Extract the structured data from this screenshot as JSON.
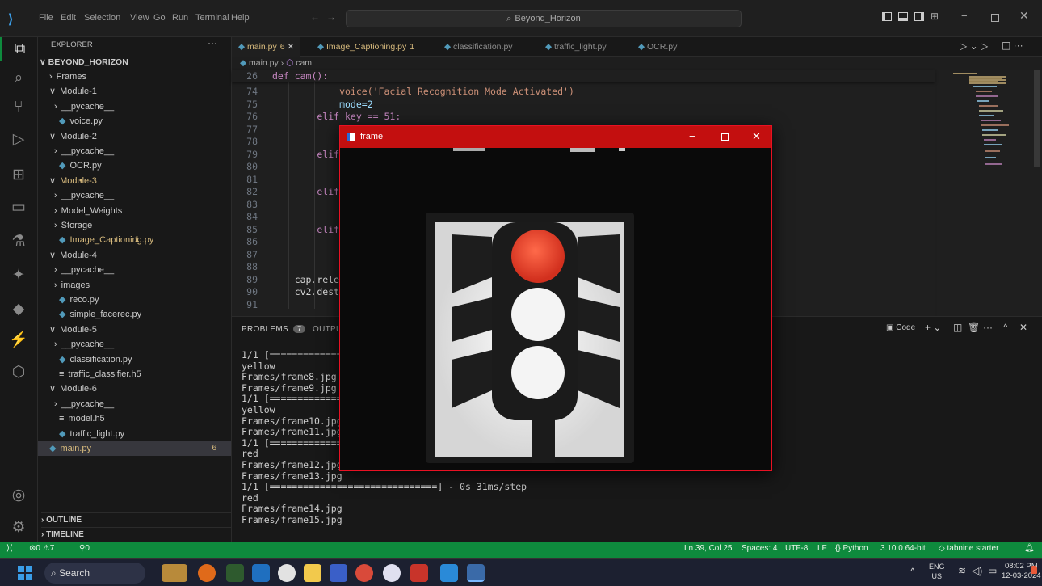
{
  "titlebar": {
    "menus": [
      "File",
      "Edit",
      "Selection",
      "View",
      "Go",
      "Run",
      "Terminal",
      "Help"
    ],
    "search_text": "Beyond_Horizon"
  },
  "sidebar": {
    "header": "EXPLORER",
    "project": "BEYOND_HORIZON",
    "items": [
      {
        "label": "Frames",
        "depth": 1,
        "kind": "folder",
        "open": false
      },
      {
        "label": "Module-1",
        "depth": 1,
        "kind": "folder",
        "open": true
      },
      {
        "label": "__pycache__",
        "depth": 2,
        "kind": "folder",
        "open": false
      },
      {
        "label": "voice.py",
        "depth": 2,
        "kind": "py"
      },
      {
        "label": "Module-2",
        "depth": 1,
        "kind": "folder",
        "open": true
      },
      {
        "label": "__pycache__",
        "depth": 2,
        "kind": "folder",
        "open": false
      },
      {
        "label": "OCR.py",
        "depth": 2,
        "kind": "py"
      },
      {
        "label": "Module-3",
        "depth": 1,
        "kind": "folder",
        "open": true,
        "modified": true
      },
      {
        "label": "__pycache__",
        "depth": 2,
        "kind": "folder",
        "open": false
      },
      {
        "label": "Model_Weights",
        "depth": 2,
        "kind": "folder",
        "open": false
      },
      {
        "label": "Storage",
        "depth": 2,
        "kind": "folder",
        "open": false
      },
      {
        "label": "Image_Captioning.py",
        "depth": 2,
        "kind": "py",
        "modified": true,
        "count": "1"
      },
      {
        "label": "Module-4",
        "depth": 1,
        "kind": "folder",
        "open": true
      },
      {
        "label": "__pycache__",
        "depth": 2,
        "kind": "folder",
        "open": false
      },
      {
        "label": "images",
        "depth": 2,
        "kind": "folder",
        "open": false
      },
      {
        "label": "reco.py",
        "depth": 2,
        "kind": "py"
      },
      {
        "label": "simple_facerec.py",
        "depth": 2,
        "kind": "py"
      },
      {
        "label": "Module-5",
        "depth": 1,
        "kind": "folder",
        "open": true
      },
      {
        "label": "__pycache__",
        "depth": 2,
        "kind": "folder",
        "open": false
      },
      {
        "label": "classification.py",
        "depth": 2,
        "kind": "py"
      },
      {
        "label": "traffic_classifier.h5",
        "depth": 2,
        "kind": "h5"
      },
      {
        "label": "Module-6",
        "depth": 1,
        "kind": "folder",
        "open": true
      },
      {
        "label": "__pycache__",
        "depth": 2,
        "kind": "folder",
        "open": false
      },
      {
        "label": "model.h5",
        "depth": 2,
        "kind": "h5"
      },
      {
        "label": "traffic_light.py",
        "depth": 2,
        "kind": "py"
      },
      {
        "label": "main.py",
        "depth": 1,
        "kind": "py",
        "modified": true,
        "selected": true,
        "count": "6"
      }
    ],
    "outline": "OUTLINE",
    "timeline": "TIMELINE"
  },
  "tabs": [
    {
      "label": "main.py",
      "badge": "6",
      "active": true
    },
    {
      "label": "Image_Captioning.py",
      "badge": "1"
    },
    {
      "label": "classification.py"
    },
    {
      "label": "traffic_light.py"
    },
    {
      "label": "OCR.py"
    }
  ],
  "breadcrumb": {
    "file": "main.py",
    "symbol": "cam"
  },
  "code": {
    "sticky": {
      "num": "26",
      "text": "def cam():"
    },
    "lines": [
      {
        "num": "74",
        "text": "            voice('Facial Recognition Mode Activated')"
      },
      {
        "num": "75",
        "text": "            mode=2"
      },
      {
        "num": "76",
        "text": "        elif key == 51:"
      },
      {
        "num": "77",
        "text": ""
      },
      {
        "num": "78",
        "text": ""
      },
      {
        "num": "79",
        "text": "        elif"
      },
      {
        "num": "80",
        "text": ""
      },
      {
        "num": "81",
        "text": ""
      },
      {
        "num": "82",
        "text": "        elif"
      },
      {
        "num": "83",
        "text": ""
      },
      {
        "num": "84",
        "text": ""
      },
      {
        "num": "85",
        "text": "        elif"
      },
      {
        "num": "86",
        "text": ""
      },
      {
        "num": "87",
        "text": ""
      },
      {
        "num": "88",
        "text": ""
      },
      {
        "num": "89",
        "text": "    cap.rele"
      },
      {
        "num": "90",
        "text": "    cv2.dest"
      },
      {
        "num": "91",
        "text": ""
      }
    ]
  },
  "panel": {
    "tabs": [
      "PROBLEMS",
      "OUTPUT"
    ],
    "problems_count": "7",
    "terminal_label": "Code",
    "lines": [
      "1/1 [=============",
      "yellow",
      "Frames/frame8.jpg",
      "Frames/frame9.jpg",
      "1/1 [=============",
      "yellow",
      "Frames/frame10.jpg",
      "Frames/frame11.jpg",
      "1/1 [=============",
      "red",
      "Frames/frame12.jpg",
      "Frames/frame13.jpg",
      "1/1 [==============================] - 0s 31ms/step",
      "red",
      "Frames/frame14.jpg",
      "Frames/frame15.jpg"
    ]
  },
  "frame_window": {
    "title": "frame"
  },
  "statusbar": {
    "left": {
      "errors": "0",
      "warnings": "7",
      "ports": "0"
    },
    "right": [
      "Ln 39, Col 25",
      "Spaces: 4",
      "UTF-8",
      "LF",
      "Python",
      "3.10.0 64-bit",
      "tabnine starter"
    ]
  },
  "taskbar": {
    "search": "Search",
    "lang": "ENG",
    "region": "US",
    "time": "08:02 PM",
    "date": "12-03-2024"
  },
  "colors": {
    "status_bar": "#0e8a3d",
    "frame_title": "#c30f0f",
    "red_light": "#e8432c",
    "tab_modified": "#d7ba7d"
  }
}
